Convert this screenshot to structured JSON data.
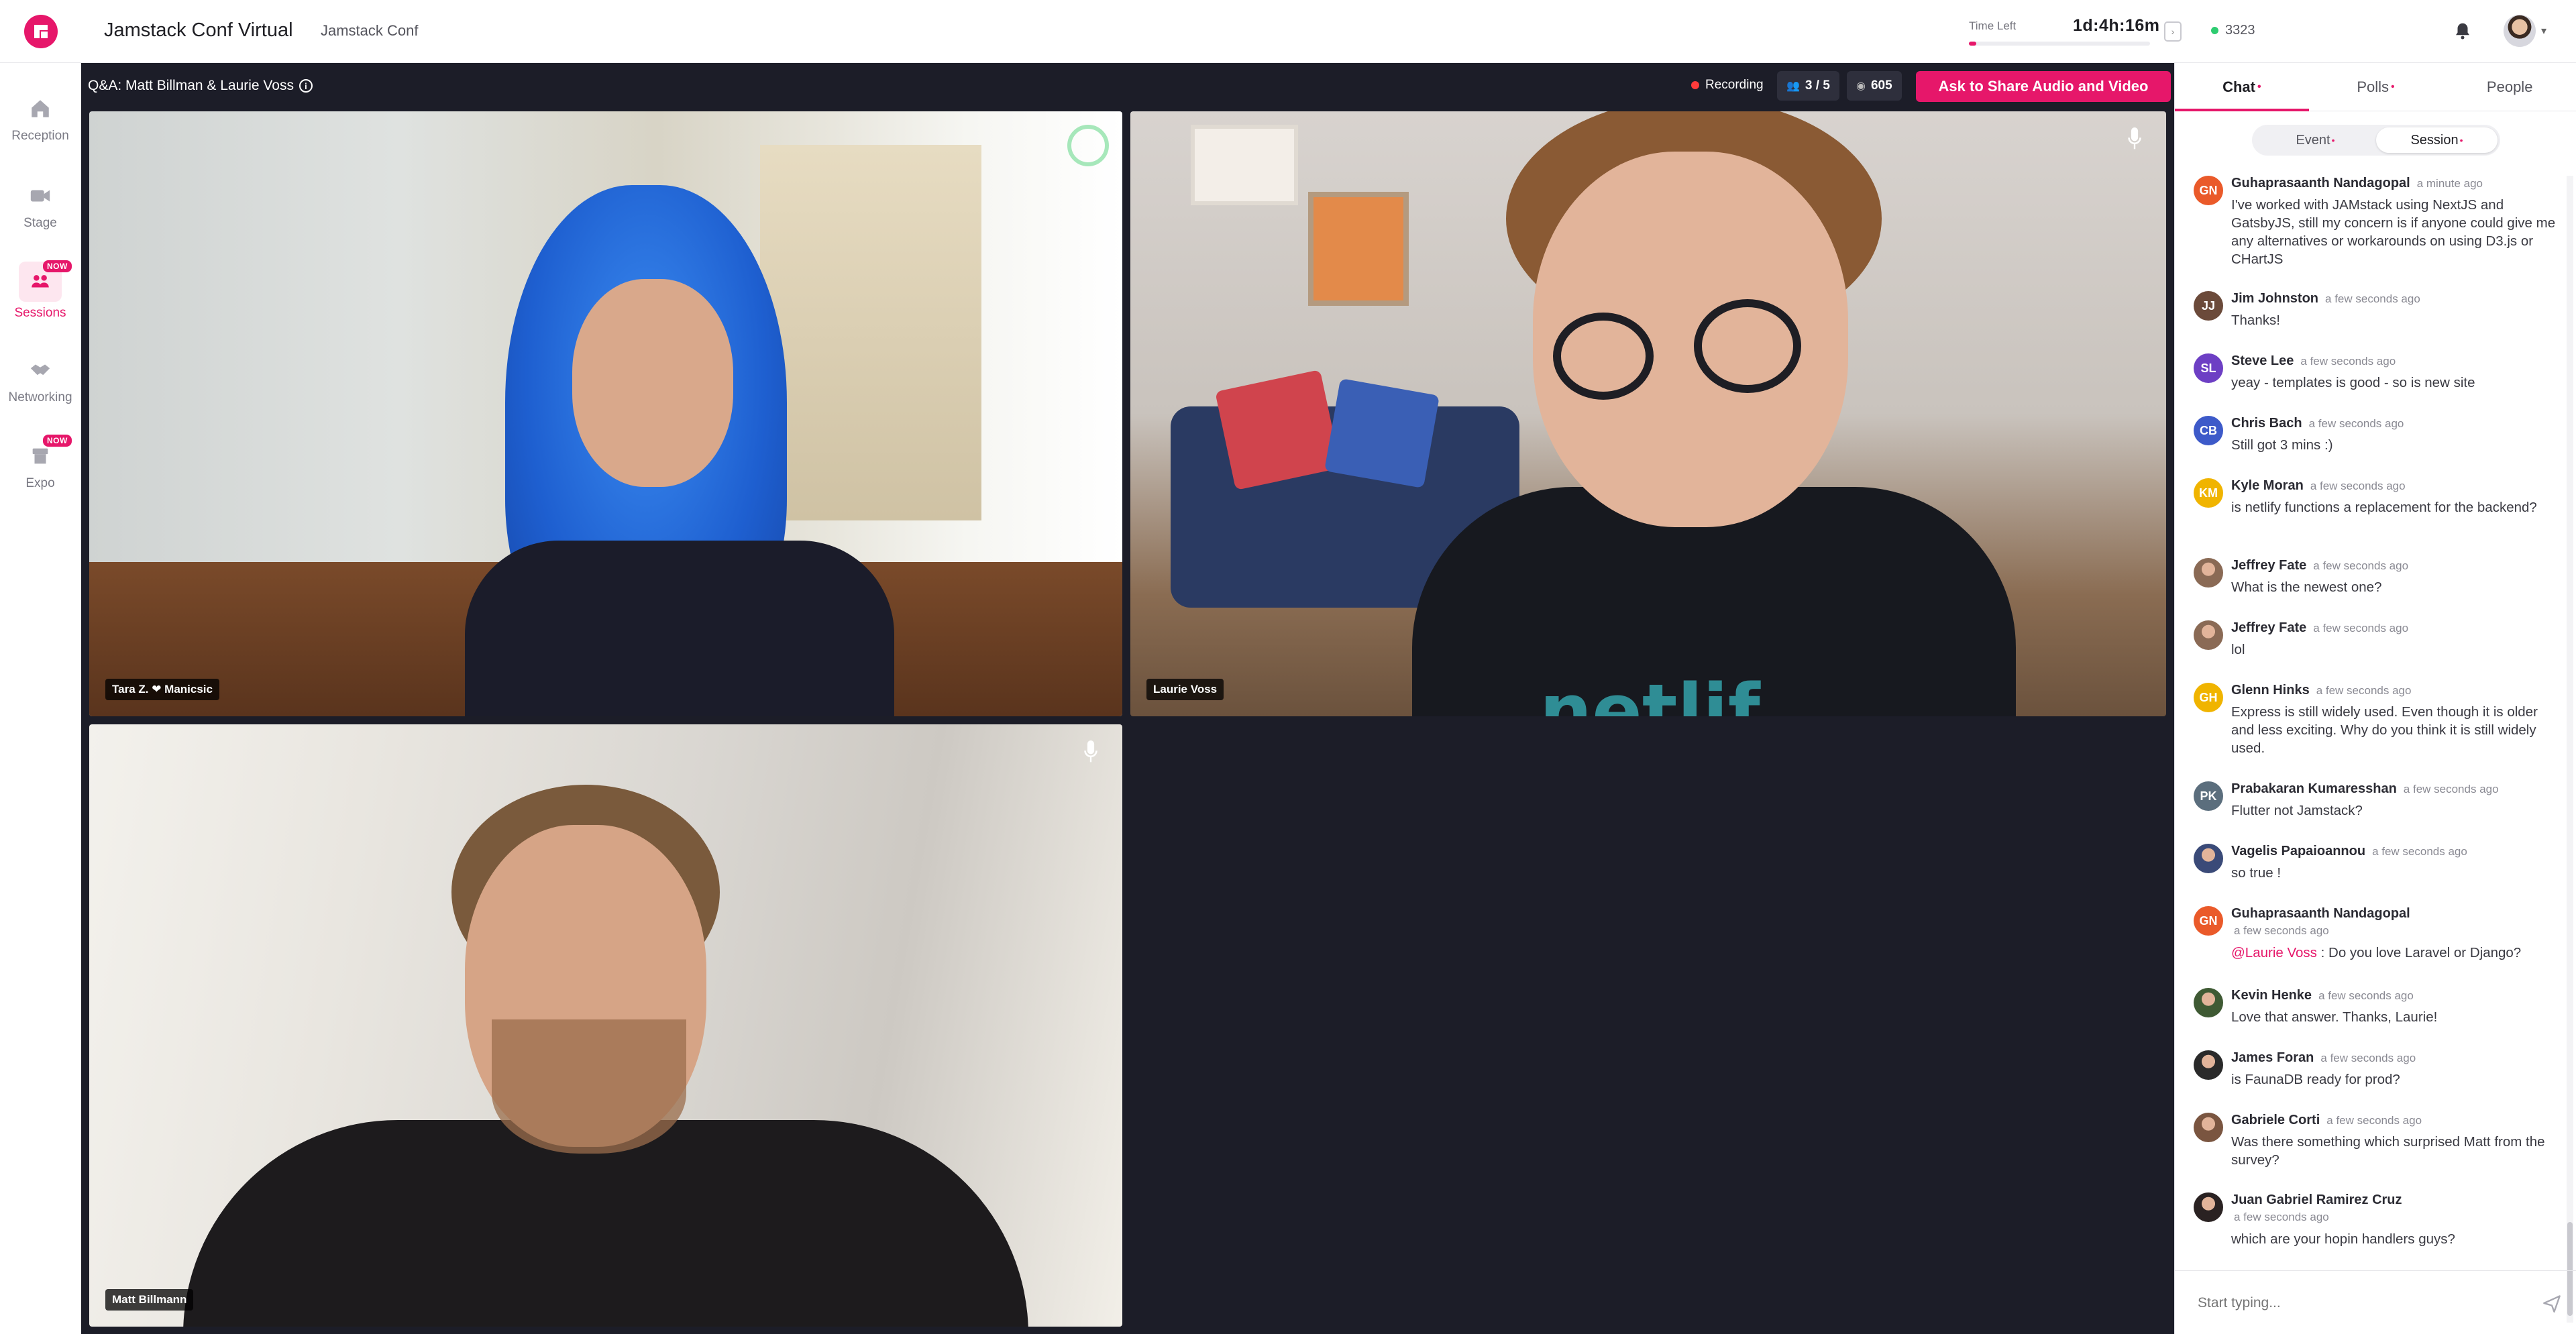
{
  "header": {
    "app_title": "Jamstack Conf Virtual",
    "org_name": "Jamstack Conf",
    "time_left_label": "Time Left",
    "time_left_value": "1d:4h:16m",
    "time_progress": 0.04,
    "online_count": "3323",
    "collapse_icon": "sidebar-collapse-icon",
    "bell_icon": "bell-icon",
    "accent_color": "#e6176a"
  },
  "nav": {
    "items": [
      {
        "label": "Reception",
        "icon": "home-icon"
      },
      {
        "label": "Stage",
        "icon": "video-camera-icon"
      },
      {
        "label": "Sessions",
        "icon": "sessions-icon",
        "badge": "NOW",
        "active": true
      },
      {
        "label": "Networking",
        "icon": "handshake-icon"
      },
      {
        "label": "Expo",
        "icon": "booth-icon",
        "badge": "NOW"
      }
    ]
  },
  "stage": {
    "title": "Q&A: Matt Billman & Laurie Voss",
    "recording_label": "Recording",
    "participants": "3 / 5",
    "viewers": "605",
    "ask_button": "Ask to Share Audio and Video",
    "tiles": [
      {
        "name": "Tara Z. ❤ Manicsic"
      },
      {
        "name": "Laurie Voss"
      },
      {
        "name": "Matt Billmann"
      }
    ],
    "shirt_text": "netlif"
  },
  "sidebar": {
    "tabs": [
      {
        "label": "Chat",
        "active": true,
        "dot": true
      },
      {
        "label": "Polls",
        "dot": true
      },
      {
        "label": "People"
      }
    ],
    "segments": [
      {
        "label": "Event",
        "dot": true
      },
      {
        "label": "Session",
        "dot": true,
        "active": true
      }
    ],
    "messages": [
      {
        "initials": "GN",
        "color": "#ea5a2a",
        "name": "Guhaprasaanth Nandagopal",
        "time": "a minute ago",
        "text": "I've worked with JAMstack using NextJS and GatsbyJS, still my concern is if anyone could give me any alternatives or workarounds on using D3.js or CHartJS"
      },
      {
        "initials": "JJ",
        "color": "#6b4a3a",
        "name": "Jim Johnston",
        "time": "a few seconds ago",
        "text": "Thanks!"
      },
      {
        "initials": "SL",
        "color": "#6d3fc4",
        "name": "Steve Lee",
        "time": "a few seconds ago",
        "text": "yeay - templates is good - so is new site"
      },
      {
        "initials": "CB",
        "color": "#3d5ac9",
        "name": "Chris Bach",
        "time": "a few seconds ago",
        "text": "Still got 3 mins :)"
      },
      {
        "initials": "KM",
        "color": "#f0b400",
        "name": "Kyle Moran",
        "time": "a few seconds ago",
        "text": "is netlify functions a replacement for the backend?"
      },
      {
        "initials": "",
        "color": "#8a6a55",
        "name": "Jeffrey Fate",
        "time": "a few seconds ago",
        "text": "What is the newest one?"
      },
      {
        "initials": "",
        "color": "#8a6a55",
        "name": "Jeffrey Fate",
        "time": "a few seconds ago",
        "text": "lol"
      },
      {
        "initials": "GH",
        "color": "#f0b400",
        "name": "Glenn Hinks",
        "time": "a few seconds ago",
        "text": "Express is still widely used. Even though it is older and less exciting. Why do you think it is still widely used."
      },
      {
        "initials": "PK",
        "color": "#5b6e7d",
        "name": "Prabakaran Kumaresshan",
        "time": "a few seconds ago",
        "text": "Flutter not Jamstack?"
      },
      {
        "initials": "",
        "color": "#3a4a78",
        "name": "Vagelis Papaioannou",
        "time": "a few seconds ago",
        "text": "so true !"
      },
      {
        "initials": "GN",
        "color": "#ea5a2a",
        "name": "Guhaprasaanth Nandagopal",
        "time": "a few seconds ago",
        "mention": "@Laurie Voss",
        "text": " : Do you love Laravel or Django?"
      },
      {
        "initials": "",
        "color": "#3f5a34",
        "name": "Kevin Henke",
        "time": "a few seconds ago",
        "text": "Love that answer. Thanks, Laurie!"
      },
      {
        "initials": "",
        "color": "#2a2a2a",
        "name": "James Foran",
        "time": "a few seconds ago",
        "text": "is FaunaDB ready for prod?"
      },
      {
        "initials": "",
        "color": "#7a5540",
        "name": "Gabriele Corti",
        "time": "a few seconds ago",
        "text": "Was there something which surprised Matt from the survey?"
      },
      {
        "initials": "",
        "color": "#2a2222",
        "name": "Juan Gabriel Ramirez Cruz",
        "time": "a few seconds ago",
        "text": "which are your hopin handlers guys?"
      }
    ],
    "composer_placeholder": "Start typing..."
  }
}
